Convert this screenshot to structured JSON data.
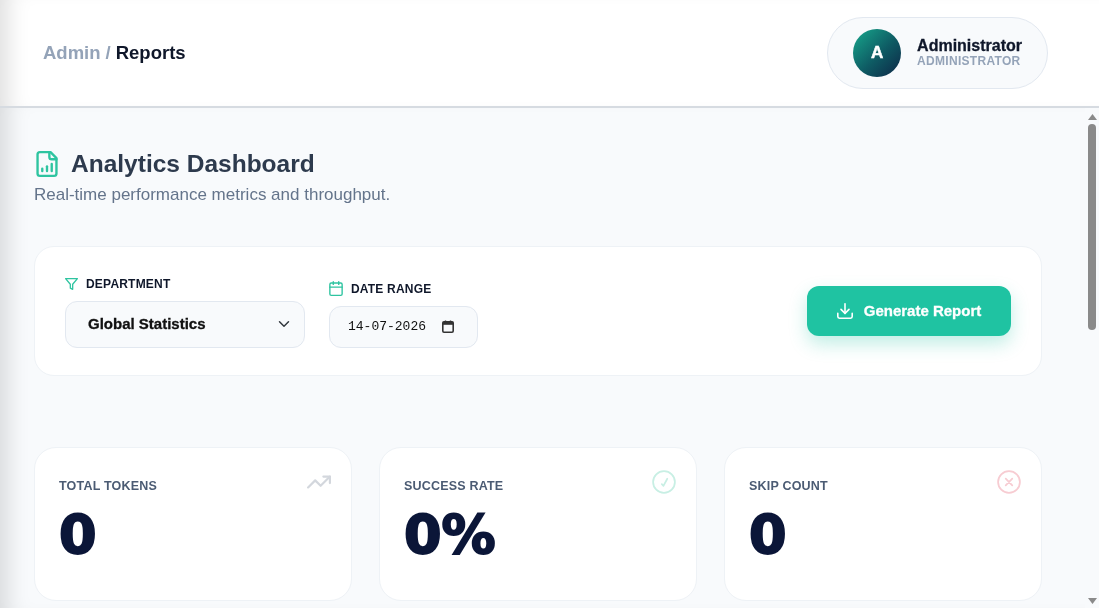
{
  "header": {
    "breadcrumb": {
      "separator": "/",
      "items": [
        {
          "label": "Admin",
          "current": false
        },
        {
          "label": "Reports",
          "current": true
        }
      ]
    },
    "user": {
      "initial": "A",
      "name": "Administrator",
      "role": "ADMINISTRATOR"
    }
  },
  "page": {
    "title": "Analytics Dashboard",
    "subtitle": "Real-time performance metrics and throughput."
  },
  "filters": {
    "department": {
      "label": "DEPARTMENT",
      "value": "Global Statistics"
    },
    "date_range": {
      "label": "DATE RANGE",
      "value": "14-07-2026"
    },
    "button": "Generate Report"
  },
  "stats": [
    {
      "kind": "trend",
      "label": "TOTAL TOKENS",
      "value": "0"
    },
    {
      "kind": "success",
      "label": "SUCCESS RATE",
      "value": "0%"
    },
    {
      "kind": "skip",
      "label": "SKIP COUNT",
      "value": "0"
    }
  ]
}
